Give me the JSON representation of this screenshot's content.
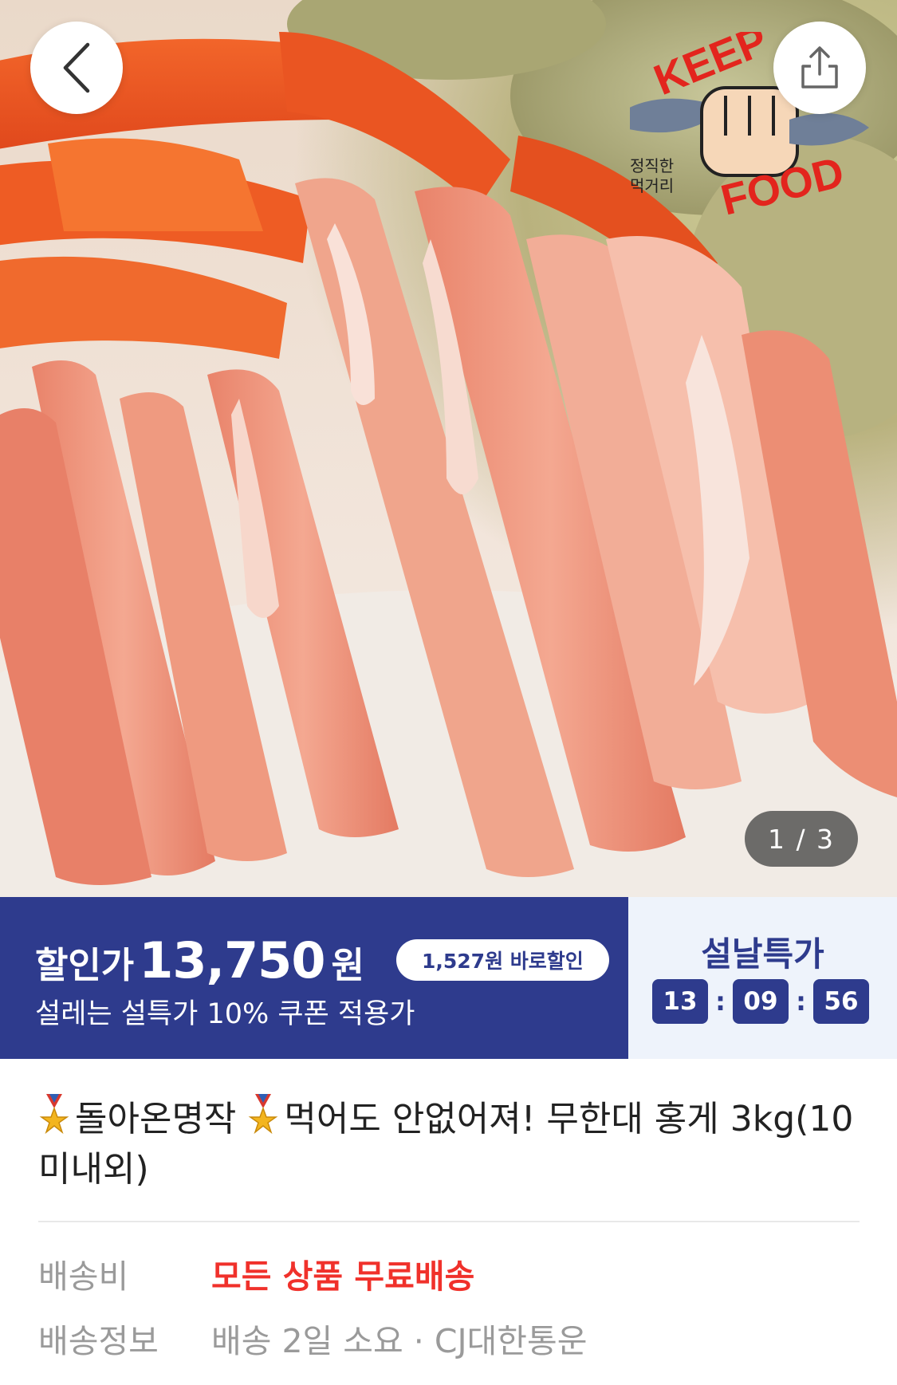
{
  "hero": {
    "counter_text": "1 / 3",
    "logo_text_top": "KEEP",
    "logo_text_bottom": "FOOD",
    "logo_tagline_1": "정직한",
    "logo_tagline_2": "먹거리"
  },
  "price": {
    "label": "할인가",
    "value": "13,750",
    "unit": "원",
    "discount_badge": "1,527원 바로할인",
    "subtitle": "설레는 설특가 10% 쿠폰 적용가",
    "deal_title": "설날특가",
    "timer": {
      "hours": "13",
      "minutes": "09",
      "seconds": "56"
    }
  },
  "product": {
    "title_part1": "돌아온명작",
    "title_part2": "먹어도 안없어져! 무한대 홍게 3kg(10미내외)"
  },
  "shipping": {
    "fee_label": "배송비",
    "fee_value": "모든 상품 무료배송",
    "info_label": "배송정보",
    "info_value": "배송 2일 소요 · CJ대한통운"
  },
  "colors": {
    "primary": "#2e3b8d",
    "free_shipping_red": "#f0312b",
    "deal_background": "#eef3fb"
  },
  "icons": [
    "back-chevron-icon",
    "share-icon",
    "medal-icon"
  ]
}
